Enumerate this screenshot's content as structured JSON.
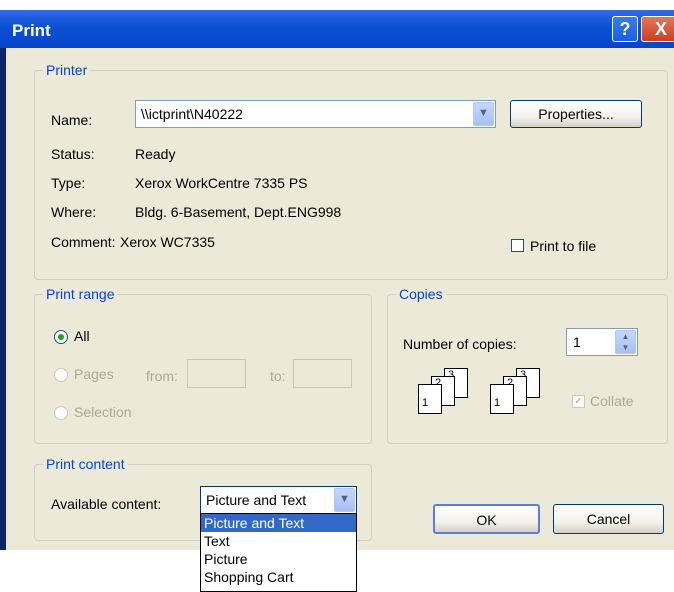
{
  "dialog": {
    "title": "Print",
    "help_glyph": "?",
    "close_glyph": "X"
  },
  "printer": {
    "legend": "Printer",
    "name_label": "Name:",
    "name_value": "\\\\ictprint\\N40222",
    "properties_label": "Properties...",
    "status_label": "Status:",
    "status_value": "Ready",
    "type_label": "Type:",
    "type_value": "Xerox WorkCentre 7335 PS",
    "where_label": "Where:",
    "where_value": "Bldg. 6-Basement, Dept.ENG998",
    "comment_label": "Comment:",
    "comment_value": "Xerox WC7335",
    "print_to_file_label": "Print to file",
    "print_to_file_checked": false
  },
  "print_range": {
    "legend": "Print range",
    "all_label": "All",
    "pages_label": "Pages",
    "from_label": "from:",
    "to_label": "to:",
    "selection_label": "Selection",
    "selected": "All"
  },
  "copies": {
    "legend": "Copies",
    "number_label": "Number of copies:",
    "number_value": "1",
    "collate_label": "Collate",
    "collate_checked": true,
    "page_digits": [
      "1",
      "2",
      "3"
    ]
  },
  "print_content": {
    "legend": "Print content",
    "available_label": "Available content:",
    "selected_value": "Picture and Text",
    "options": [
      "Picture and Text",
      "Text",
      "Picture",
      "Shopping Cart"
    ]
  },
  "buttons": {
    "ok_label": "OK",
    "cancel_label": "Cancel"
  },
  "colors": {
    "title_bar": "#0b4fd6",
    "legend_text": "#0046d5",
    "close_button": "#e0452c",
    "selection_highlight": "#316ac5"
  }
}
